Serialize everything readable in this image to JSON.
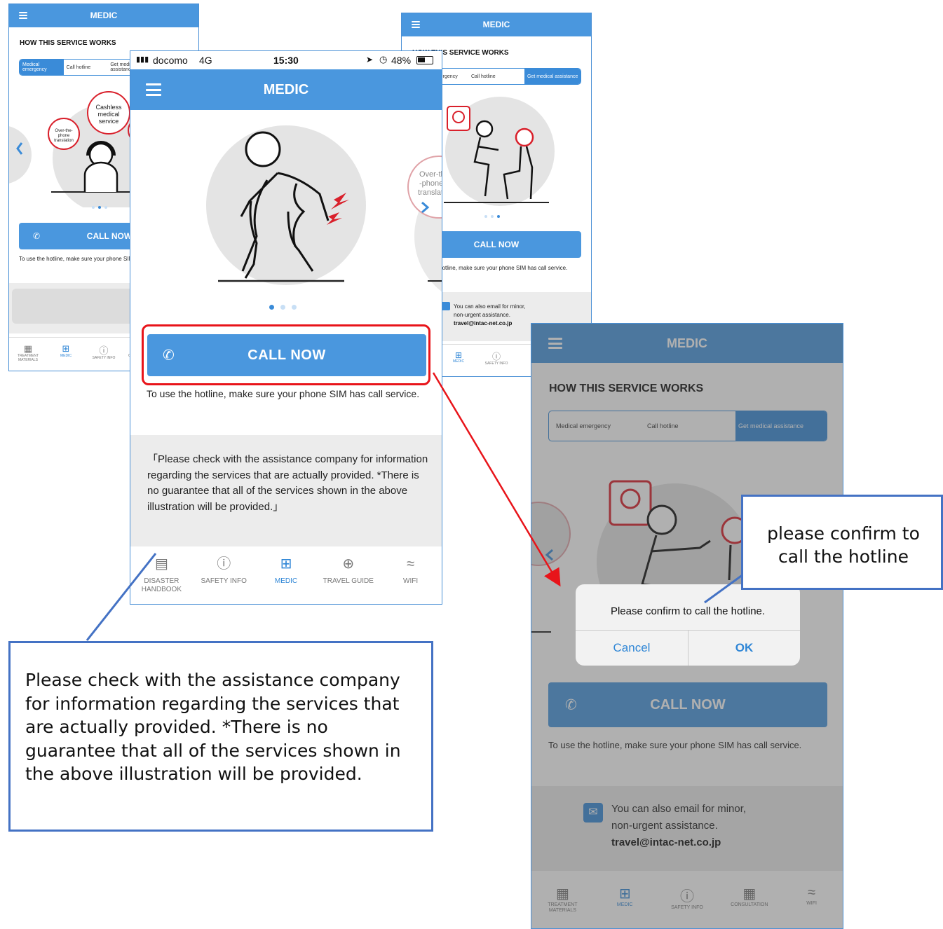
{
  "app_title": "MEDIC",
  "section_title": "HOW THIS SERVICE WORKS",
  "steps": [
    "Medical emergency",
    "Call hotline",
    "Get medical assistance"
  ],
  "call_now": "CALL NOW",
  "hotline_note": "To use the hotline, make sure your phone SIM has call service.",
  "disclaimer": "「Please check with the assistance company for information regarding the services that are actually provided. *There is no guarantee that all of the services shown in the above illustration will be provided.」",
  "email_note_1": "You can also email for minor,",
  "email_note_2": "non-urgent assistance.",
  "email_address": "travel@intac-net.co.jp",
  "bubbles": {
    "cashless": "Cashless medical service",
    "over_phone_small": "Over-the-phone translation",
    "over_phone_large": "Over-the-phone translation"
  },
  "status_bar": {
    "carrier": "docomo",
    "network": "4G",
    "time": "15:30",
    "battery": "48%"
  },
  "tabs_main": [
    {
      "label": "DISASTER HANDBOOK",
      "icon": "book-icon"
    },
    {
      "label": "SAFETY INFO",
      "icon": "alert-icon"
    },
    {
      "label": "MEDIC",
      "icon": "medkit-icon"
    },
    {
      "label": "TRAVEL GUIDE",
      "icon": "globe-icon"
    },
    {
      "label": "WIFI",
      "icon": "wifi-icon"
    }
  ],
  "tabs_small": [
    "TREATMENT MATERIALS",
    "MEDIC",
    "SAFETY INFO",
    "CONSULTATION",
    "WIFI"
  ],
  "dialog": {
    "message": "Please confirm to call the hotline.",
    "cancel": "Cancel",
    "ok": "OK"
  },
  "callout_dialog": "please confirm to call the hotline",
  "callout_disclaimer": "Please check with the assistance company for information regarding the services that are actually provided. *There is no guarantee that all of the services shown in the above illustration will be provided.",
  "colors": {
    "accent": "#4a97de",
    "highlight": "#e8141a",
    "callout_border": "#4472c4"
  }
}
